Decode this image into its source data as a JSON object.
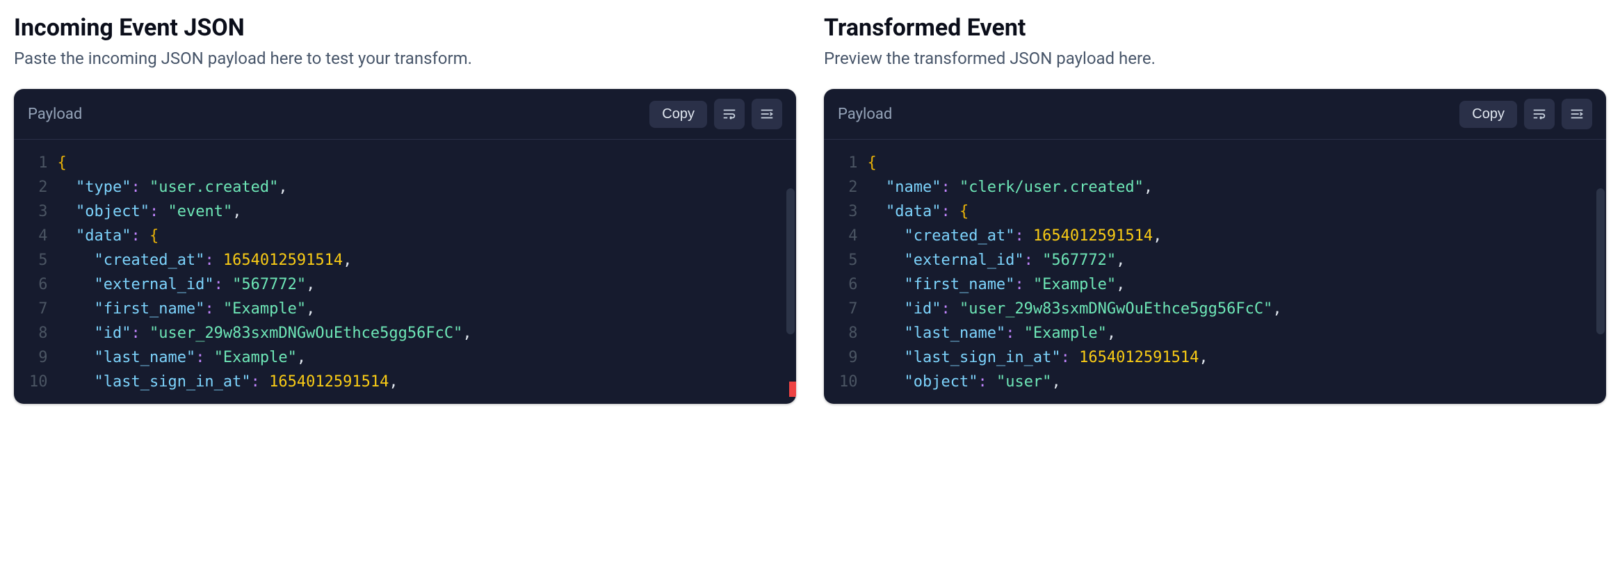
{
  "left": {
    "title": "Incoming Event JSON",
    "subtitle": "Paste the incoming JSON payload here to test your transform.",
    "header_label": "Payload",
    "copy_label": "Copy",
    "code": [
      [
        {
          "t": "brace",
          "v": "{"
        }
      ],
      [
        {
          "t": "indent",
          "v": "  "
        },
        {
          "t": "key",
          "v": "\"type\""
        },
        {
          "t": "punct",
          "v": ":"
        },
        {
          "t": "sp",
          "v": " "
        },
        {
          "t": "str",
          "v": "\"user.created\""
        },
        {
          "t": "comma",
          "v": ","
        }
      ],
      [
        {
          "t": "indent",
          "v": "  "
        },
        {
          "t": "key",
          "v": "\"object\""
        },
        {
          "t": "punct",
          "v": ":"
        },
        {
          "t": "sp",
          "v": " "
        },
        {
          "t": "str",
          "v": "\"event\""
        },
        {
          "t": "comma",
          "v": ","
        }
      ],
      [
        {
          "t": "indent",
          "v": "  "
        },
        {
          "t": "key",
          "v": "\"data\""
        },
        {
          "t": "punct",
          "v": ":"
        },
        {
          "t": "sp",
          "v": " "
        },
        {
          "t": "brace",
          "v": "{"
        }
      ],
      [
        {
          "t": "indent",
          "v": "    "
        },
        {
          "t": "key",
          "v": "\"created_at\""
        },
        {
          "t": "punct",
          "v": ":"
        },
        {
          "t": "sp",
          "v": " "
        },
        {
          "t": "num",
          "v": "1654012591514"
        },
        {
          "t": "comma",
          "v": ","
        }
      ],
      [
        {
          "t": "indent",
          "v": "    "
        },
        {
          "t": "key",
          "v": "\"external_id\""
        },
        {
          "t": "punct",
          "v": ":"
        },
        {
          "t": "sp",
          "v": " "
        },
        {
          "t": "str",
          "v": "\"567772\""
        },
        {
          "t": "comma",
          "v": ","
        }
      ],
      [
        {
          "t": "indent",
          "v": "    "
        },
        {
          "t": "key",
          "v": "\"first_name\""
        },
        {
          "t": "punct",
          "v": ":"
        },
        {
          "t": "sp",
          "v": " "
        },
        {
          "t": "str",
          "v": "\"Example\""
        },
        {
          "t": "comma",
          "v": ","
        }
      ],
      [
        {
          "t": "indent",
          "v": "    "
        },
        {
          "t": "key",
          "v": "\"id\""
        },
        {
          "t": "punct",
          "v": ":"
        },
        {
          "t": "sp",
          "v": " "
        },
        {
          "t": "str",
          "v": "\"user_29w83sxmDNGwOuEthce5gg56FcC\""
        },
        {
          "t": "comma",
          "v": ","
        }
      ],
      [
        {
          "t": "indent",
          "v": "    "
        },
        {
          "t": "key",
          "v": "\"last_name\""
        },
        {
          "t": "punct",
          "v": ":"
        },
        {
          "t": "sp",
          "v": " "
        },
        {
          "t": "str",
          "v": "\"Example\""
        },
        {
          "t": "comma",
          "v": ","
        }
      ],
      [
        {
          "t": "indent",
          "v": "    "
        },
        {
          "t": "key",
          "v": "\"last_sign_in_at\""
        },
        {
          "t": "punct",
          "v": ":"
        },
        {
          "t": "sp",
          "v": " "
        },
        {
          "t": "num",
          "v": "1654012591514"
        },
        {
          "t": "comma",
          "v": ","
        }
      ]
    ]
  },
  "right": {
    "title": "Transformed Event",
    "subtitle": "Preview the transformed JSON payload here.",
    "header_label": "Payload",
    "copy_label": "Copy",
    "code": [
      [
        {
          "t": "brace",
          "v": "{"
        }
      ],
      [
        {
          "t": "indent",
          "v": "  "
        },
        {
          "t": "key",
          "v": "\"name\""
        },
        {
          "t": "punct",
          "v": ":"
        },
        {
          "t": "sp",
          "v": " "
        },
        {
          "t": "str",
          "v": "\"clerk/user.created\""
        },
        {
          "t": "comma",
          "v": ","
        }
      ],
      [
        {
          "t": "indent",
          "v": "  "
        },
        {
          "t": "key",
          "v": "\"data\""
        },
        {
          "t": "punct",
          "v": ":"
        },
        {
          "t": "sp",
          "v": " "
        },
        {
          "t": "brace",
          "v": "{"
        }
      ],
      [
        {
          "t": "indent",
          "v": "    "
        },
        {
          "t": "key",
          "v": "\"created_at\""
        },
        {
          "t": "punct",
          "v": ":"
        },
        {
          "t": "sp",
          "v": " "
        },
        {
          "t": "num",
          "v": "1654012591514"
        },
        {
          "t": "comma",
          "v": ","
        }
      ],
      [
        {
          "t": "indent",
          "v": "    "
        },
        {
          "t": "key",
          "v": "\"external_id\""
        },
        {
          "t": "punct",
          "v": ":"
        },
        {
          "t": "sp",
          "v": " "
        },
        {
          "t": "str",
          "v": "\"567772\""
        },
        {
          "t": "comma",
          "v": ","
        }
      ],
      [
        {
          "t": "indent",
          "v": "    "
        },
        {
          "t": "key",
          "v": "\"first_name\""
        },
        {
          "t": "punct",
          "v": ":"
        },
        {
          "t": "sp",
          "v": " "
        },
        {
          "t": "str",
          "v": "\"Example\""
        },
        {
          "t": "comma",
          "v": ","
        }
      ],
      [
        {
          "t": "indent",
          "v": "    "
        },
        {
          "t": "key",
          "v": "\"id\""
        },
        {
          "t": "punct",
          "v": ":"
        },
        {
          "t": "sp",
          "v": " "
        },
        {
          "t": "str",
          "v": "\"user_29w83sxmDNGwOuEthce5gg56FcC\""
        },
        {
          "t": "comma",
          "v": ","
        }
      ],
      [
        {
          "t": "indent",
          "v": "    "
        },
        {
          "t": "key",
          "v": "\"last_name\""
        },
        {
          "t": "punct",
          "v": ":"
        },
        {
          "t": "sp",
          "v": " "
        },
        {
          "t": "str",
          "v": "\"Example\""
        },
        {
          "t": "comma",
          "v": ","
        }
      ],
      [
        {
          "t": "indent",
          "v": "    "
        },
        {
          "t": "key",
          "v": "\"last_sign_in_at\""
        },
        {
          "t": "punct",
          "v": ":"
        },
        {
          "t": "sp",
          "v": " "
        },
        {
          "t": "num",
          "v": "1654012591514"
        },
        {
          "t": "comma",
          "v": ","
        }
      ],
      [
        {
          "t": "indent",
          "v": "    "
        },
        {
          "t": "key",
          "v": "\"object\""
        },
        {
          "t": "punct",
          "v": ":"
        },
        {
          "t": "sp",
          "v": " "
        },
        {
          "t": "str",
          "v": "\"user\""
        },
        {
          "t": "comma",
          "v": ","
        }
      ]
    ]
  }
}
